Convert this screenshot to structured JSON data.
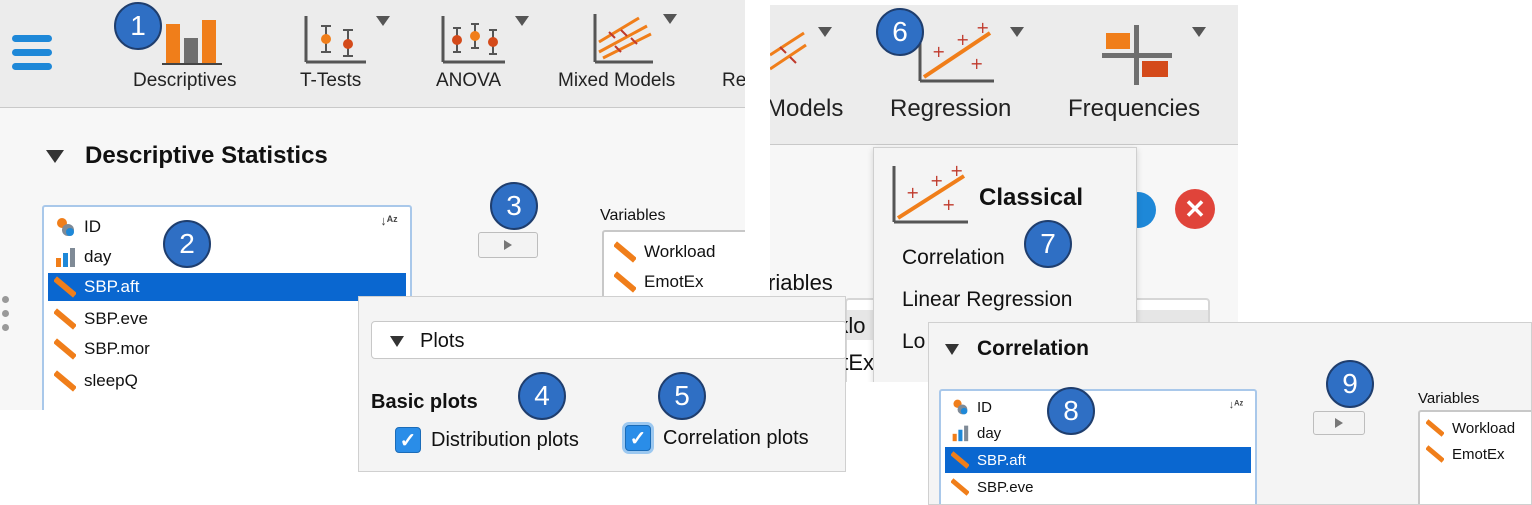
{
  "badges": [
    "1",
    "2",
    "3",
    "4",
    "5",
    "6",
    "7",
    "8",
    "9"
  ],
  "ribbon_left": {
    "items": [
      {
        "label": "Descriptives",
        "icon": "descriptives-icon"
      },
      {
        "label": "T-Tests",
        "icon": "t-tests-icon"
      },
      {
        "label": "ANOVA",
        "icon": "anova-icon"
      },
      {
        "label": "Mixed Models",
        "icon": "mixed-models-icon"
      },
      {
        "label": "Re",
        "icon": "regression-icon"
      }
    ]
  },
  "descriptive_panel": {
    "title": "Descriptive Statistics",
    "variables_label": "Variables",
    "source_vars": [
      {
        "name": "ID",
        "type": "nominal"
      },
      {
        "name": "day",
        "type": "ordinal"
      },
      {
        "name": "SBP.aft",
        "type": "scale",
        "selected": true
      },
      {
        "name": "SBP.eve",
        "type": "scale"
      },
      {
        "name": "SBP.mor",
        "type": "scale"
      },
      {
        "name": "sleepQ",
        "type": "scale"
      }
    ],
    "target_vars": [
      "Workload",
      "EmotEx"
    ]
  },
  "ribbon_right": {
    "items": [
      {
        "label": "Models"
      },
      {
        "label": "Regression"
      },
      {
        "label": "Frequencies"
      }
    ]
  },
  "regression_menu": {
    "header": "Classical",
    "items": [
      "Correlation",
      "Linear Regression",
      "Lo"
    ]
  },
  "partial_texts": {
    "riables": "riables",
    "rklo": "rklo",
    "otex": "otEx"
  },
  "plots_panel": {
    "section": "Plots",
    "group_title": "Basic plots",
    "options": [
      {
        "label": "Distribution plots",
        "checked": true
      },
      {
        "label": "Correlation plots",
        "checked": true
      }
    ]
  },
  "correlation_panel": {
    "title": "Correlation",
    "variables_label": "Variables",
    "source_vars": [
      {
        "name": "ID",
        "type": "nominal"
      },
      {
        "name": "day",
        "type": "ordinal"
      },
      {
        "name": "SBP.aft",
        "type": "scale",
        "selected": true
      },
      {
        "name": "SBP.eve",
        "type": "scale"
      }
    ],
    "target_vars": [
      "Workload",
      "EmotEx"
    ]
  },
  "colors": {
    "accent": "#0a67d0",
    "badge": "#2f6fc4",
    "ribbon": "#ececec",
    "bar_orange": "#f07e1a"
  }
}
